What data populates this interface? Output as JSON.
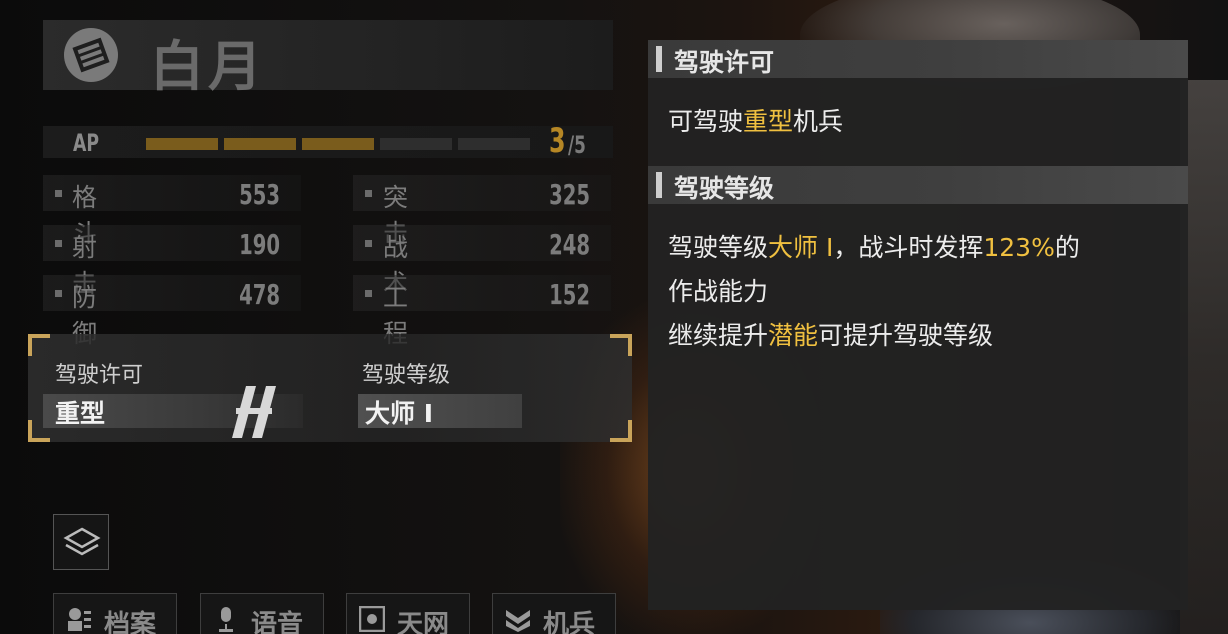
{
  "character": {
    "name": "白月",
    "emblem_icon": "faction-emblem-icon"
  },
  "ap": {
    "label": "AP",
    "current": "3",
    "max": "/5",
    "filled_segments": 3,
    "total_segments": 5
  },
  "stats": [
    {
      "label": "格斗",
      "value": "553"
    },
    {
      "label": "突击",
      "value": "325"
    },
    {
      "label": "射击",
      "value": "190"
    },
    {
      "label": "战术",
      "value": "248"
    },
    {
      "label": "防御",
      "value": "478"
    },
    {
      "label": "工程",
      "value": "152"
    }
  ],
  "license": {
    "license_label": "驾驶许可",
    "license_value": "重型",
    "level_label": "驾驶等级",
    "level_value": "大师 I"
  },
  "bottom_tabs": [
    {
      "label": "档案",
      "icon": "profile-icon"
    },
    {
      "label": "语音",
      "icon": "microphone-icon"
    },
    {
      "label": "天网",
      "icon": "network-icon"
    },
    {
      "label": "机兵",
      "icon": "mech-icon"
    }
  ],
  "info_panel": {
    "section1_title": "驾驶许可",
    "section1_text": {
      "pre": "可驾驶",
      "highlight": "重型",
      "post": "机兵"
    },
    "section2_title": "驾驶等级",
    "section2_text": {
      "line1_a": "驾驶等级",
      "line1_hl1": "大师 I",
      "line1_b": "，战斗时发挥",
      "line1_hl2": "123%",
      "line1_c": "的",
      "line2": "作战能力",
      "line3_a": "继续提升",
      "line3_hl": "潜能",
      "line3_b": "可提升驾驶等级"
    }
  },
  "colors": {
    "accent_gold": "#f0c040",
    "ap_gold": "#b68725",
    "corner_gold": "#c9a45a"
  }
}
